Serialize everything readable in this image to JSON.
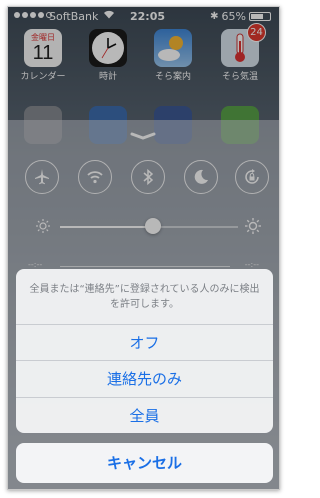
{
  "status_bar": {
    "carrier": "SoftBank",
    "time": "22:05",
    "battery": "65%",
    "battery_level": 0.65,
    "signal_bars_filled": 4,
    "signal_bars_total": 5
  },
  "home": {
    "calendar_weekday": "金曜日",
    "calendar_day": "11",
    "apps": [
      {
        "label": "カレンダー"
      },
      {
        "label": "時計"
      },
      {
        "label": "そら案内"
      },
      {
        "label": "そら気温"
      }
    ],
    "badge_count": "24"
  },
  "control_center": {
    "toggles": [
      {
        "icon": "airplane-icon"
      },
      {
        "icon": "wifi-icon"
      },
      {
        "icon": "bluetooth-icon"
      },
      {
        "icon": "moon-icon"
      },
      {
        "icon": "rotation-lock-icon"
      }
    ],
    "brightness_level": 0.52,
    "music_left": "--:--",
    "music_right": "--:--"
  },
  "action_sheet": {
    "message": "全員または“連絡先”に登録されている人のみに検出を許可します。",
    "options": [
      {
        "label": "オフ"
      },
      {
        "label": "連絡先のみ"
      },
      {
        "label": "全員"
      }
    ],
    "cancel_label": "キャンセル"
  },
  "colors": {
    "accent": "#1a6fe6",
    "badge": "#e03a2e"
  }
}
